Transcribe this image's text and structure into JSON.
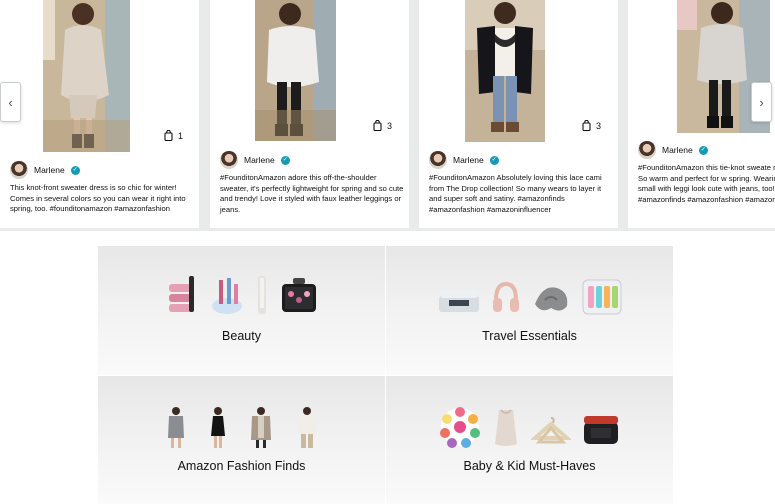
{
  "carousel": {
    "prev_icon": "chevron-left-icon",
    "next_icon": "chevron-right-icon",
    "cards": [
      {
        "author": "Marlene",
        "product_count": "1",
        "caption": "This knot-front sweater dress is so chic for winter! Comes in several colors so you can wear it right into spring, too. #founditonamazon #amazonfashion"
      },
      {
        "author": "Marlene",
        "product_count": "3",
        "caption": "#FounditonAmazon adore this off-the-shoulder sweater, it's perfectly lightweight for spring and so cute and trendy! Love it styled with faux leather leggings or jeans."
      },
      {
        "author": "Marlene",
        "product_count": "3",
        "caption": "#FounditonAmazon Absolutely loving this lace cami from The Drop collection! So many wears to layer it and super soft and satiny. #amazonfinds #amazonfashion #amazoninfluencer"
      },
      {
        "author": "Marlene",
        "product_count": "",
        "caption": "#FounditonAmazon this tie-knot sweate my favorites! So warm and perfect for w spring. Wearing a size small with leggi look cute with jeans, too! #amazonfinds #amazonfashion #amazoninfluencer"
      }
    ]
  },
  "categories": [
    {
      "label": "Beauty",
      "icons": [
        "curling-wand-icon",
        "brush-set-icon",
        "hair-tool-icon",
        "makeup-case-icon"
      ]
    },
    {
      "label": "Travel Essentials",
      "icons": [
        "uv-sanitizer-icon",
        "headphones-icon",
        "travel-pillow-icon",
        "toiletry-bottles-icon"
      ]
    },
    {
      "label": "Amazon Fashion Finds",
      "icons": [
        "sweater-dress-icon",
        "black-dress-icon",
        "cardigan-icon",
        "sweater-icon"
      ]
    },
    {
      "label": "Baby & Kid Must-Haves",
      "icons": [
        "hair-bows-icon",
        "sleep-sack-icon",
        "hangers-icon",
        "booster-seat-icon"
      ]
    }
  ]
}
